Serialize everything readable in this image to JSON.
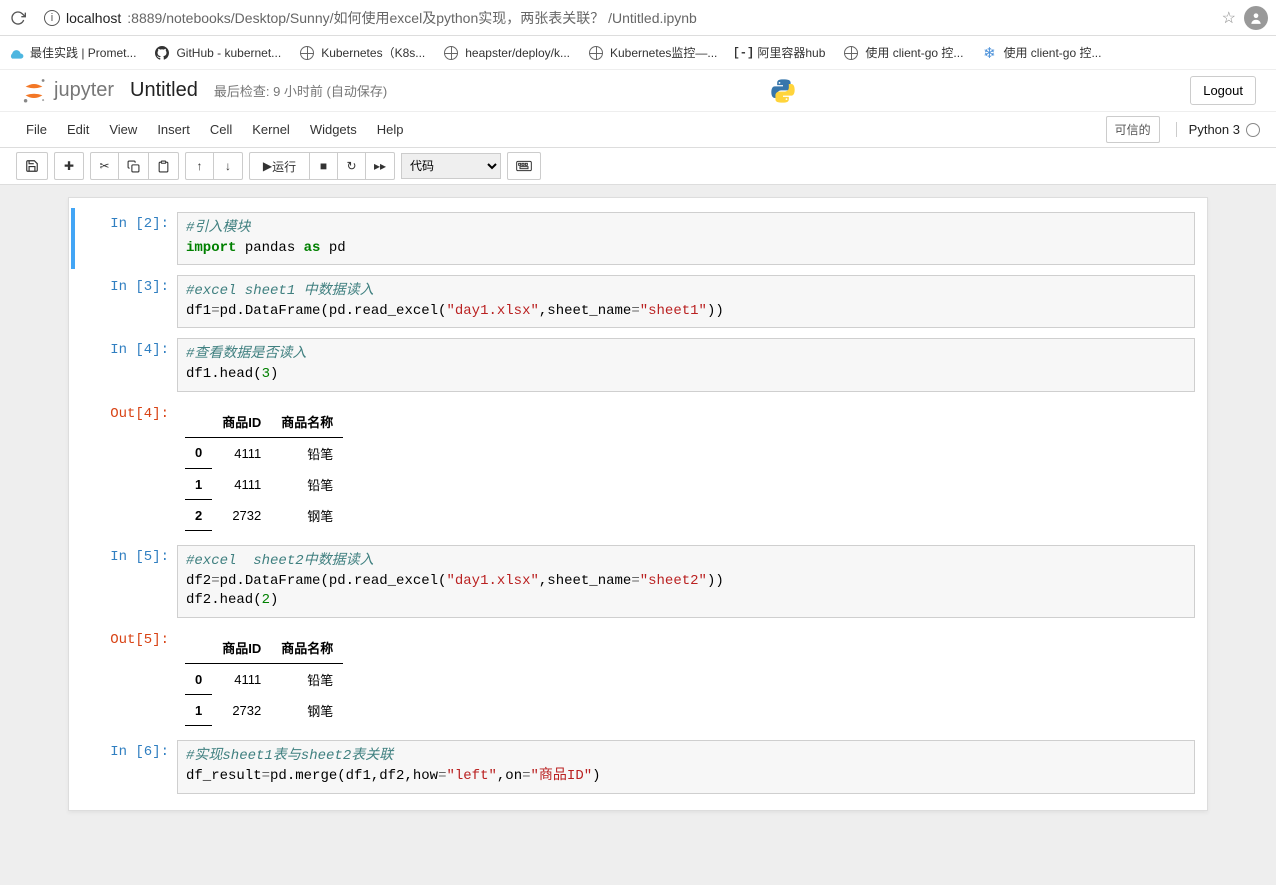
{
  "browser": {
    "host": "localhost",
    "port_path": ":8889/notebooks/Desktop/Sunny/如何使用excel及python实现，两张表关联？ /Untitled.ipynb"
  },
  "bookmarks": [
    {
      "label": "最佳实践 | Promet...",
      "icon": "cloud"
    },
    {
      "label": "GitHub - kubernet...",
      "icon": "github"
    },
    {
      "label": "Kubernetes（K8s...",
      "icon": "globe"
    },
    {
      "label": "heapster/deploy/k...",
      "icon": "globe"
    },
    {
      "label": "Kubernetes监控—...",
      "icon": "globe"
    },
    {
      "label": "阿里容器hub",
      "icon": "ali"
    },
    {
      "label": "使用 client-go 控...",
      "icon": "globe"
    },
    {
      "label": "使用 client-go 控...",
      "icon": "snowflake"
    }
  ],
  "header": {
    "jupyter": "jupyter",
    "title": "Untitled",
    "checkpoint": "最后检查: 9 小时前",
    "autosave": "(自动保存)",
    "logout": "Logout"
  },
  "menubar": {
    "items": [
      "File",
      "Edit",
      "View",
      "Insert",
      "Cell",
      "Kernel",
      "Widgets",
      "Help"
    ],
    "trusted": "可信的",
    "kernel": "Python 3"
  },
  "toolbar": {
    "run_label": "运行",
    "celltype": "代码"
  },
  "cells": [
    {
      "prompt": "In [2]:",
      "selected": true,
      "code_html": "<span class='c-comment'>#引入模块</span>\n<span class='c-keyword'>import</span> pandas <span class='c-keyword'>as</span> pd"
    },
    {
      "prompt": "In [3]:",
      "code_html": "<span class='c-comment'>#excel sheet1 中数据读入</span>\ndf1<span class='c-op'>=</span>pd.DataFrame(pd.read_excel(<span class='c-string'>\"day1.xlsx\"</span>,sheet_name<span class='c-op'>=</span><span class='c-string'>\"sheet1\"</span>))"
    },
    {
      "prompt": "In [4]:",
      "code_html": "<span class='c-comment'>#查看数据是否读入</span>\ndf1.head(<span class='c-num'>3</span>)",
      "out_prompt": "Out[4]:",
      "table": {
        "columns": [
          "商品ID",
          "商品名称"
        ],
        "rows": [
          {
            "idx": "0",
            "cells": [
              "4111",
              "铅笔"
            ]
          },
          {
            "idx": "1",
            "cells": [
              "4111",
              "铅笔"
            ]
          },
          {
            "idx": "2",
            "cells": [
              "2732",
              "钢笔"
            ]
          }
        ]
      }
    },
    {
      "prompt": "In [5]:",
      "code_html": "<span class='c-comment'>#excel  sheet2中数据读入</span>\ndf2<span class='c-op'>=</span>pd.DataFrame(pd.read_excel(<span class='c-string'>\"day1.xlsx\"</span>,sheet_name<span class='c-op'>=</span><span class='c-string'>\"sheet2\"</span>))\ndf2.head(<span class='c-num'>2</span>)",
      "out_prompt": "Out[5]:",
      "table": {
        "columns": [
          "商品ID",
          "商品名称"
        ],
        "rows": [
          {
            "idx": "0",
            "cells": [
              "4111",
              "铅笔"
            ]
          },
          {
            "idx": "1",
            "cells": [
              "2732",
              "钢笔"
            ]
          }
        ]
      }
    },
    {
      "prompt": "In [6]:",
      "code_html": "<span class='c-comment'>#实现sheet1表与sheet2表关联</span>\ndf_result<span class='c-op'>=</span>pd.merge(df1,df2,how<span class='c-op'>=</span><span class='c-string'>\"left\"</span>,on<span class='c-op'>=</span><span class='c-string'>\"商品ID\"</span>)"
    }
  ]
}
